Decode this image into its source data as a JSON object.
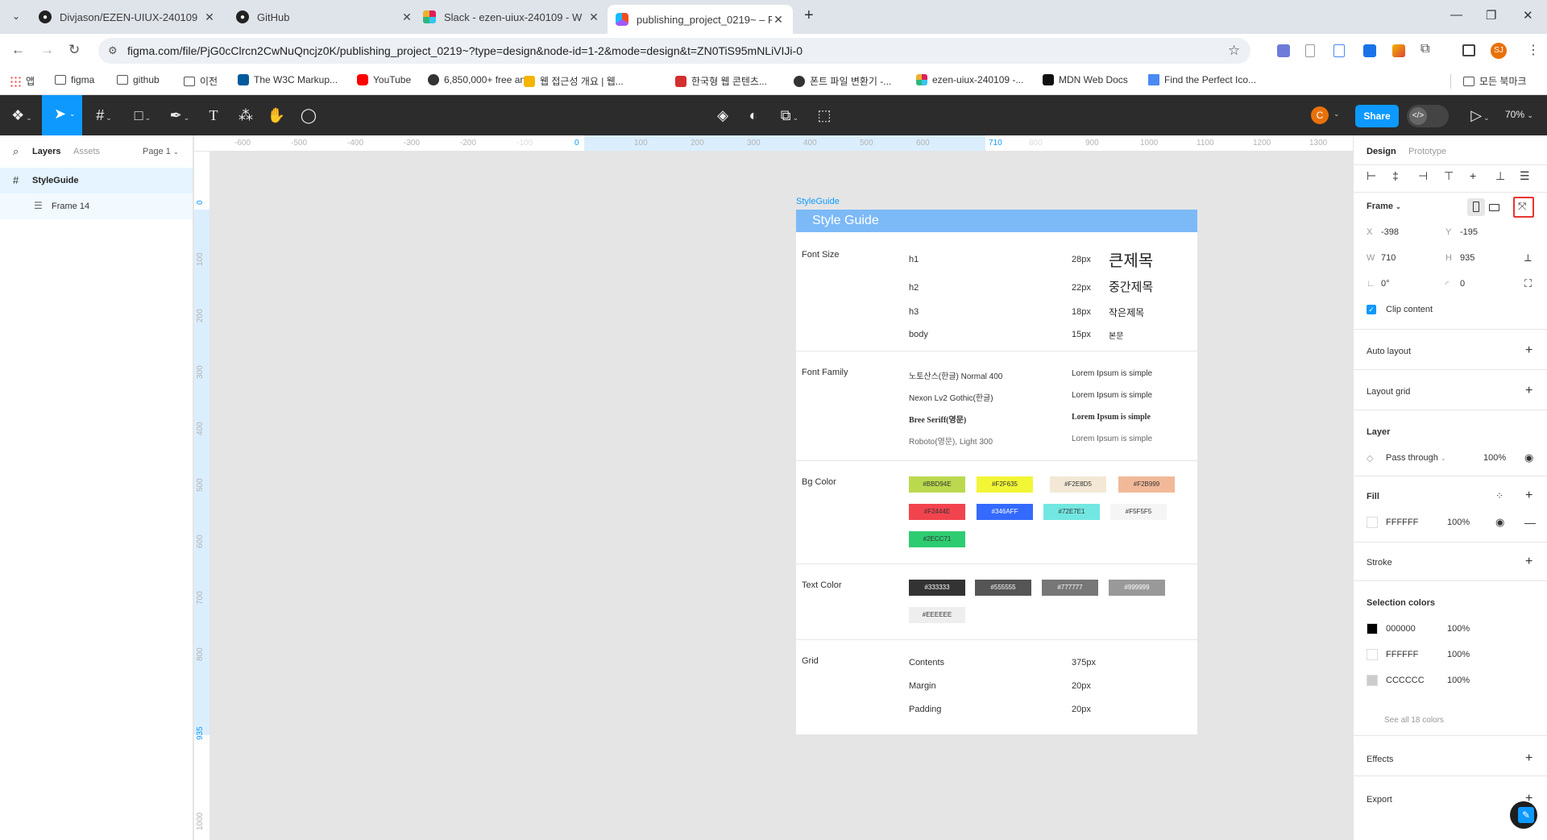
{
  "browser": {
    "tabs": [
      {
        "title": "Divjason/EZEN-UIUX-240109",
        "icon": "github-icon",
        "active": false
      },
      {
        "title": "GitHub",
        "icon": "github-icon",
        "active": false
      },
      {
        "title": "Slack - ezen-uiux-240109 - W",
        "icon": "slack-icon",
        "active": false
      },
      {
        "title": "publishing_project_0219~ – Fi",
        "icon": "figma-icon",
        "active": true
      }
    ],
    "url": "figma.com/file/PjG0cClrcn2CwNuQncjz0K/publishing_project_0219~?type=design&node-id=1-2&mode=design&t=ZN0TiS95mNLiVIJi-0",
    "profile_initials": "SJ",
    "bookmarks": [
      {
        "label": "앱",
        "kind": "grid"
      },
      {
        "label": "figma",
        "kind": "folder"
      },
      {
        "label": "github",
        "kind": "folder"
      },
      {
        "label": "이전",
        "kind": "folder"
      },
      {
        "label": "The W3C Markup...",
        "kind": "w3c"
      },
      {
        "label": "YouTube",
        "kind": "youtube"
      },
      {
        "label": "6,850,000+ free an...",
        "kind": "site"
      },
      {
        "label": "웹 접근성 개요 | 웹...",
        "kind": "site"
      },
      {
        "label": "한국형 웹 콘텐츠...",
        "kind": "pdf"
      },
      {
        "label": "폰트 파일 변환기 -...",
        "kind": "tool"
      },
      {
        "label": "ezen-uiux-240109 -...",
        "kind": "slack"
      },
      {
        "label": "MDN Web Docs",
        "kind": "mdn"
      },
      {
        "label": "Find the Perfect Ico...",
        "kind": "flag"
      }
    ],
    "bookmarks_right": "모든 북마크"
  },
  "toolbar": {
    "share_label": "Share",
    "zoom": "70%",
    "user_initial": "C"
  },
  "left_panel": {
    "tab_layers": "Layers",
    "tab_assets": "Assets",
    "page": "Page 1",
    "layers": [
      {
        "name": "StyleGuide",
        "level": 0,
        "icon": "frame-icon"
      },
      {
        "name": "Frame 14",
        "level": 1,
        "icon": "autolayout-icon"
      }
    ]
  },
  "rulers": {
    "top": [
      "-600",
      "-500",
      "-400",
      "-300",
      "-200",
      "-100",
      "0",
      "100",
      "200",
      "300",
      "400",
      "500",
      "600",
      "710",
      "800",
      "900",
      "1000",
      "1100",
      "1200",
      "1300"
    ],
    "left": [
      "0",
      "100",
      "200",
      "300",
      "400",
      "500",
      "600",
      "700",
      "800",
      "935",
      "1000"
    ]
  },
  "frame": {
    "label": "StyleGuide",
    "header": "Style Guide",
    "font_size": {
      "label": "Font Size",
      "rows": [
        {
          "tag": "h1",
          "size": "28px",
          "sample": "큰제목"
        },
        {
          "tag": "h2",
          "size": "22px",
          "sample": "중간제목"
        },
        {
          "tag": "h3",
          "size": "18px",
          "sample": "작은제목"
        },
        {
          "tag": "body",
          "size": "15px",
          "sample": "본문"
        }
      ]
    },
    "font_family": {
      "label": "Font Family",
      "rows": [
        {
          "name": "노토산스(한글) Normal 400",
          "sample": "Lorem Ipsum is simple"
        },
        {
          "name": "Nexon Lv2 Gothic(한글)",
          "sample": "Lorem Ipsum is simple"
        },
        {
          "name": "Bree Seriff(영문)",
          "sample": "Lorem Ipsum is simple"
        },
        {
          "name": "Roboto(영문), Light 300",
          "sample": "Lorem Ipsum is simple"
        }
      ]
    },
    "bg_color": {
      "label": "Bg Color",
      "swatches": [
        {
          "hex": "#BBD94E",
          "color": "#BBD94E",
          "text": "#333"
        },
        {
          "hex": "#F2F635",
          "color": "#F2F635",
          "text": "#333"
        },
        {
          "hex": "#F2E8D5",
          "color": "#F2E8D5",
          "text": "#333"
        },
        {
          "hex": "#F2B999",
          "color": "#F2B999",
          "text": "#333"
        },
        {
          "hex": "#F2444E",
          "color": "#F2444E",
          "text": "#333"
        },
        {
          "hex": "#346AFF",
          "color": "#346AFF",
          "text": "#fff"
        },
        {
          "hex": "#72E7E1",
          "color": "#72E7E1",
          "text": "#333"
        },
        {
          "hex": "#F5F5F5",
          "color": "#F5F5F5",
          "text": "#333"
        },
        {
          "hex": "#2ECC71",
          "color": "#2ECC71",
          "text": "#333"
        }
      ]
    },
    "text_color": {
      "label": "Text Color",
      "swatches": [
        {
          "hex": "#333333",
          "color": "#333333",
          "text": "#fff"
        },
        {
          "hex": "#555555",
          "color": "#555555",
          "text": "#fff"
        },
        {
          "hex": "#777777",
          "color": "#777777",
          "text": "#fff"
        },
        {
          "hex": "#999999",
          "color": "#999999",
          "text": "#fff"
        },
        {
          "hex": "#EEEEEE",
          "color": "#EEEEEE",
          "text": "#333"
        }
      ]
    },
    "grid": {
      "label": "Grid",
      "rows": [
        {
          "name": "Contents",
          "value": "375px"
        },
        {
          "name": "Margin",
          "value": "20px"
        },
        {
          "name": "Padding",
          "value": "20px"
        }
      ]
    }
  },
  "right_panel": {
    "tab_design": "Design",
    "tab_prototype": "Prototype",
    "frame_label": "Frame",
    "x_label": "X",
    "x": "-398",
    "y_label": "Y",
    "y": "-195",
    "w_label": "W",
    "w": "710",
    "h_label": "H",
    "h": "935",
    "rotation": "0°",
    "radius": "0",
    "clip_content": "Clip content",
    "auto_layout": "Auto layout",
    "layout_grid": "Layout grid",
    "layer": "Layer",
    "blend": "Pass through",
    "layer_opacity": "100%",
    "fill": "Fill",
    "fill_hex": "FFFFFF",
    "fill_opacity": "100%",
    "stroke": "Stroke",
    "selection_colors": "Selection colors",
    "sel_colors": [
      {
        "hex": "000000",
        "opacity": "100%",
        "color": "#000000"
      },
      {
        "hex": "FFFFFF",
        "opacity": "100%",
        "color": "#FFFFFF"
      },
      {
        "hex": "CCCCCC",
        "opacity": "100%",
        "color": "#CCCCCC"
      }
    ],
    "see_all": "See all 18 colors",
    "effects": "Effects",
    "export": "Export"
  },
  "colors": {
    "figma_blue": "#0d99ff",
    "header_blue": "#7cb9f7",
    "highlight_red": "#e8352f"
  }
}
